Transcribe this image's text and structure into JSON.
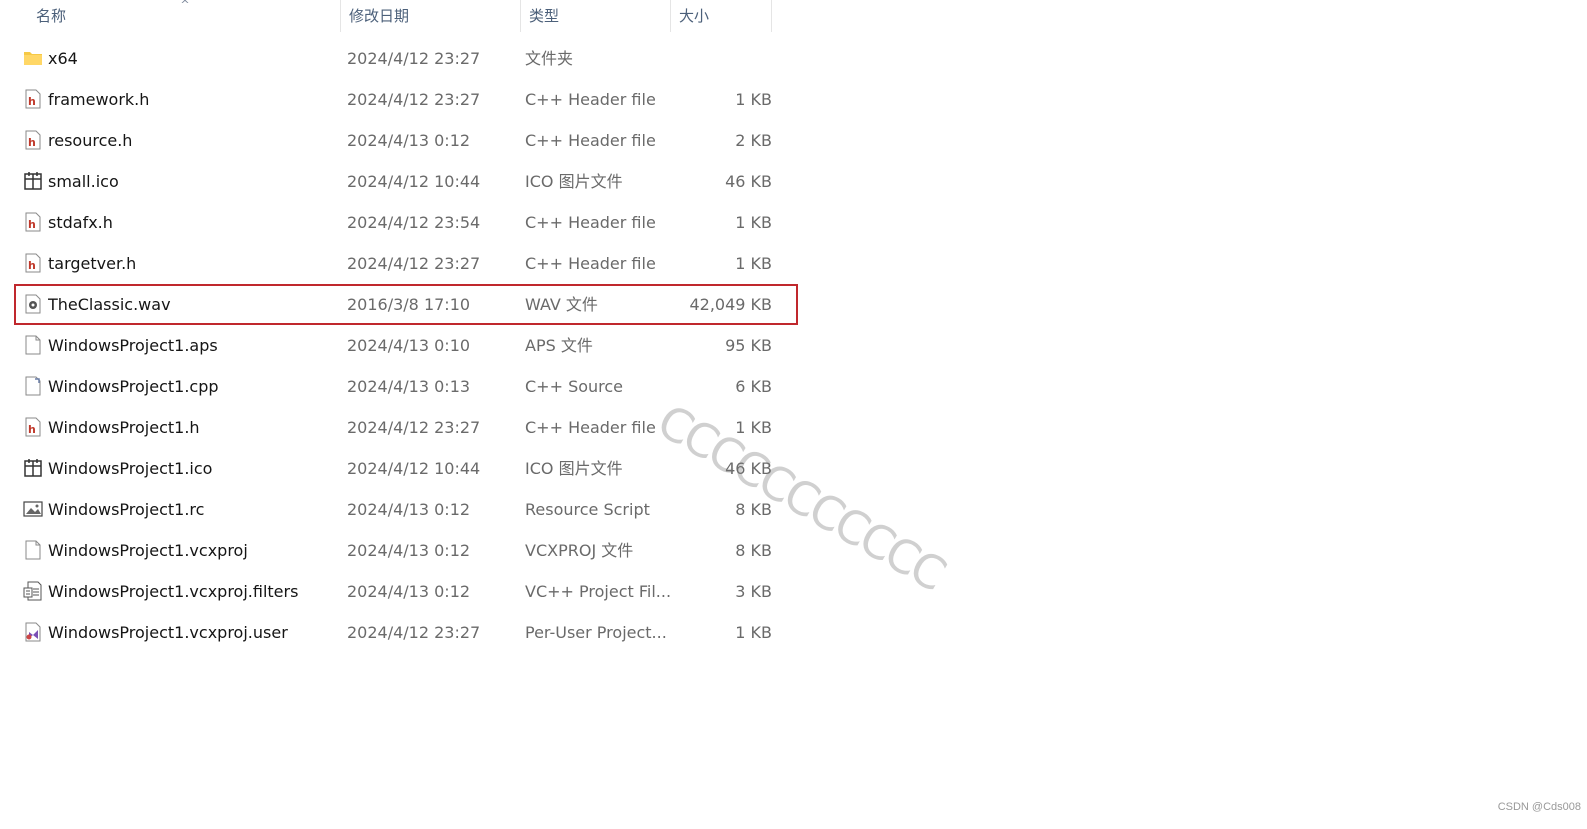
{
  "columns": {
    "name": "名称",
    "date": "修改日期",
    "type": "类型",
    "size": "大小"
  },
  "files": [
    {
      "name": "x64",
      "date": "2024/4/12 23:27",
      "type": "文件夹",
      "size": "",
      "icon": "folder-icon"
    },
    {
      "name": "framework.h",
      "date": "2024/4/12 23:27",
      "type": "C++ Header file",
      "size": "1 KB",
      "icon": "header-file-icon"
    },
    {
      "name": "resource.h",
      "date": "2024/4/13 0:12",
      "type": "C++ Header file",
      "size": "2 KB",
      "icon": "header-file-icon"
    },
    {
      "name": "small.ico",
      "date": "2024/4/12 10:44",
      "type": "ICO 图片文件",
      "size": "46 KB",
      "icon": "ico-file-icon"
    },
    {
      "name": "stdafx.h",
      "date": "2024/4/12 23:54",
      "type": "C++ Header file",
      "size": "1 KB",
      "icon": "header-file-icon"
    },
    {
      "name": "targetver.h",
      "date": "2024/4/12 23:27",
      "type": "C++ Header file",
      "size": "1 KB",
      "icon": "header-file-icon"
    },
    {
      "name": "TheClassic.wav",
      "date": "2016/3/8 17:10",
      "type": "WAV 文件",
      "size": "42,049 KB",
      "icon": "audio-file-icon"
    },
    {
      "name": "WindowsProject1.aps",
      "date": "2024/4/13 0:10",
      "type": "APS 文件",
      "size": "95 KB",
      "icon": "blank-file-icon"
    },
    {
      "name": "WindowsProject1.cpp",
      "date": "2024/4/13 0:13",
      "type": "C++ Source",
      "size": "6 KB",
      "icon": "cpp-file-icon"
    },
    {
      "name": "WindowsProject1.h",
      "date": "2024/4/12 23:27",
      "type": "C++ Header file",
      "size": "1 KB",
      "icon": "header-file-icon"
    },
    {
      "name": "WindowsProject1.ico",
      "date": "2024/4/12 10:44",
      "type": "ICO 图片文件",
      "size": "46 KB",
      "icon": "ico-file-icon"
    },
    {
      "name": "WindowsProject1.rc",
      "date": "2024/4/13 0:12",
      "type": "Resource Script",
      "size": "8 KB",
      "icon": "image-file-icon"
    },
    {
      "name": "WindowsProject1.vcxproj",
      "date": "2024/4/13 0:12",
      "type": "VCXPROJ 文件",
      "size": "8 KB",
      "icon": "blank-file-icon"
    },
    {
      "name": "WindowsProject1.vcxproj.filters",
      "date": "2024/4/13 0:12",
      "type": "VC++ Project Fil...",
      "size": "3 KB",
      "icon": "filters-file-icon"
    },
    {
      "name": "WindowsProject1.vcxproj.user",
      "date": "2024/4/12 23:27",
      "type": "Per-User Project...",
      "size": "1 KB",
      "icon": "vs-user-file-icon"
    }
  ],
  "highlighted_row": "TheClassic.wav",
  "highlight_color": "#c0282d",
  "watermark": "CCCCCCCCCCC",
  "credit": "CSDN @Cds008"
}
